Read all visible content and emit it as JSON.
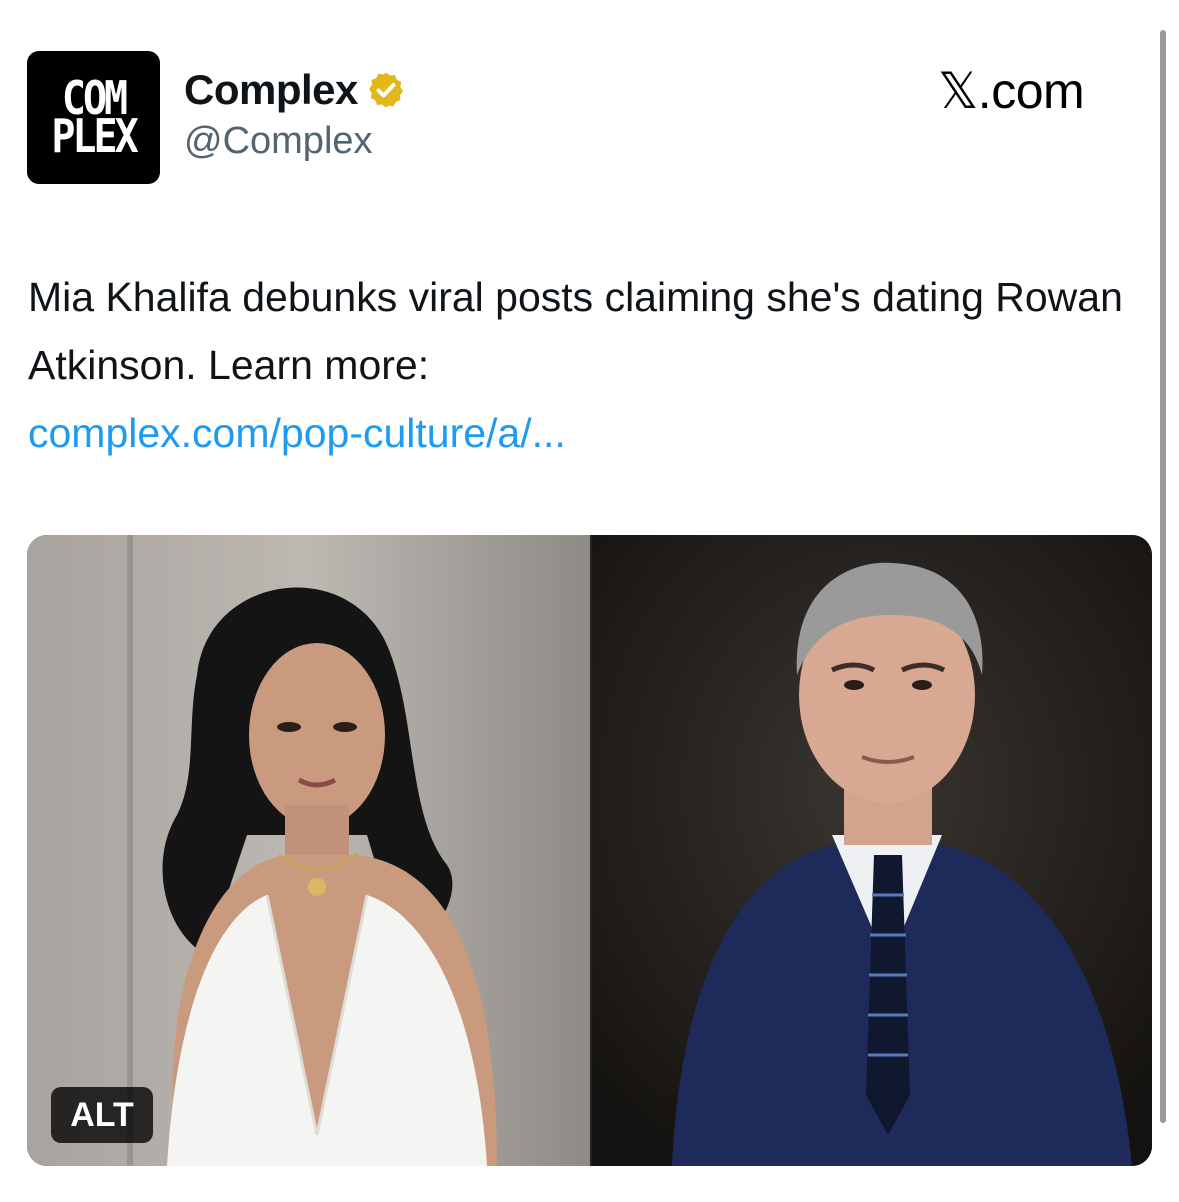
{
  "account": {
    "logo_line1": "COM",
    "logo_line2": "PLEX",
    "name": "Complex",
    "handle": "@Complex",
    "verified_icon": "verified-badge-icon",
    "verified_color": "#e2b719"
  },
  "brand": {
    "x": "𝕏",
    "rest": ".com"
  },
  "tweet": {
    "text": "Mia Khalifa debunks viral posts claiming she's dating Rowan Atkinson. Learn more:",
    "link": "complex.com/pop-culture/a/..."
  },
  "media": {
    "alt_label": "ALT"
  },
  "colors": {
    "link": "#1d9bf0",
    "handle": "#536471",
    "text": "#0f1419"
  }
}
